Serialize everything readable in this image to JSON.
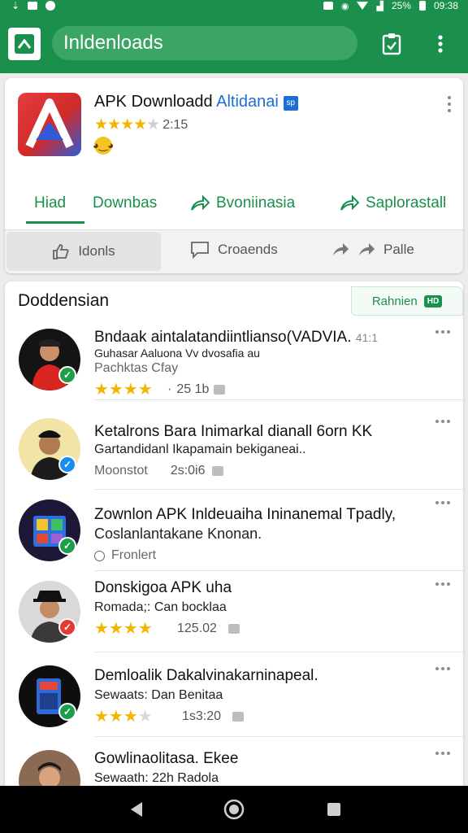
{
  "status_bar": {
    "battery": "25%",
    "time": "09:38"
  },
  "toolbar": {
    "search_value": "Inldenloads"
  },
  "app": {
    "name": "APK Downloadd",
    "developer": "Altidanai",
    "verified_label": "sp",
    "rating_value": "2:15",
    "stars": 4
  },
  "tabs": [
    {
      "label": "Hiad"
    },
    {
      "label": "Downbas"
    },
    {
      "label": "Bvoniinasia"
    },
    {
      "label": "Saplorastall"
    }
  ],
  "actions": [
    {
      "label": "Idonls"
    },
    {
      "label": "Croaends"
    },
    {
      "label": "Palle"
    }
  ],
  "list": {
    "title": "Doddensian",
    "chip_label": "Rahnien",
    "chip_badge": "HD",
    "items": [
      {
        "title": "Bndaak aintalatandiintlianso(VADVIA.",
        "badge_text": "41:1",
        "subtitle": "Guhasar Aaluona Vv dvosafia au",
        "meta": "Pachktas Cfay",
        "stars": 4,
        "value": "25 1b",
        "badge_color": "#1e9e4a"
      },
      {
        "title": "Ketalrons Bara Inimarkal dianall 6orn KK",
        "subtitle": "Gartandidanl Ikapamain bekiganeai..",
        "meta": "Moonstot",
        "value": "2s:0i6",
        "badge_color": "#1a8ef0"
      },
      {
        "title": "Zownlon APK Inldeuaiha Ininanemal Tpadly,",
        "subtitle": "Coslanlantakane Knonan.",
        "meta": "Fronlert",
        "badge_color": "#1e9e4a"
      },
      {
        "title": "Donskigoa APK uha",
        "subtitle": "Romada;: Can bocklaa",
        "stars": 4,
        "value": "125.02",
        "badge_color": "#e53935"
      },
      {
        "title": "Demloalik Dakalvinakarninapeal.",
        "subtitle": "Sewaats: Dan Benitaa",
        "stars": 3.5,
        "value": "1s3:20",
        "badge_color": "#1e9e4a"
      },
      {
        "title": "Gowlinaolitasa. Ekee",
        "subtitle": "Sewaath: 22h Radola",
        "badge_color": "#1e9e4a"
      }
    ]
  },
  "icons": {
    "back": "back-triangle-icon",
    "home": "home-circle-icon",
    "recents": "recents-square-icon"
  }
}
